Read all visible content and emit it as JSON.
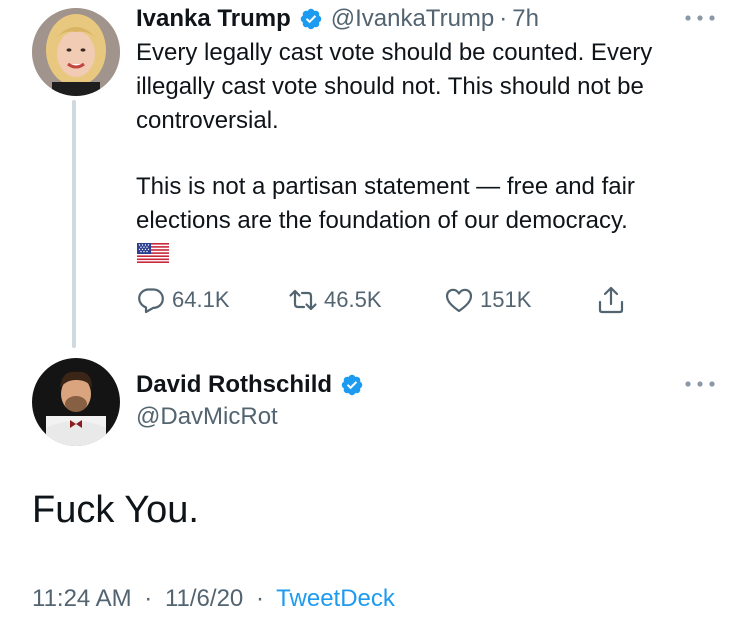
{
  "colors": {
    "text": "#0f1419",
    "secondary": "#536471",
    "accent": "#1d9bf0",
    "thread_line": "#cfd9de"
  },
  "tweet": {
    "author": {
      "display_name": "Ivanka Trump",
      "handle": "@IvankaTrump",
      "verified": true,
      "avatar_icon": "avatar-photo"
    },
    "time": "7h",
    "separator": "·",
    "text_paragraphs": [
      "Every legally cast vote should be counted. Every illegally cast vote should not. This should not be controversial.",
      "This is not a partisan statement — free and fair elections are the foundation of our democracy."
    ],
    "emoji": "us-flag-emoji",
    "actions": {
      "replies": "64.1K",
      "retweets": "46.5K",
      "likes": "151K",
      "reply_icon": "reply-icon",
      "retweet_icon": "retweet-icon",
      "like_icon": "heart-icon",
      "share_icon": "share-icon"
    },
    "more_icon": "more-icon"
  },
  "reply": {
    "author": {
      "display_name": "David Rothschild",
      "handle": "@DavMicRot",
      "verified": true,
      "avatar_icon": "avatar-photo"
    },
    "text": "Fuck You.",
    "timestamp": "11:24 AM",
    "date": "11/6/20",
    "separator": "·",
    "source": "TweetDeck",
    "more_icon": "more-icon"
  }
}
